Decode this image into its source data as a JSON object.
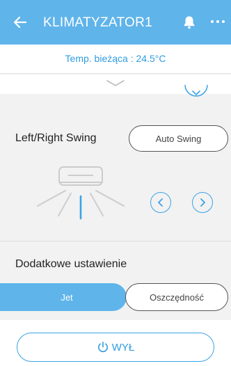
{
  "header": {
    "title": "KLIMATYZATOR1",
    "back_icon": "arrow-left-icon",
    "bell_icon": "bell-icon",
    "more_icon": "more-horizontal-icon",
    "color": "#5fb4ea"
  },
  "status": {
    "current_temp": "Temp. bieżąca : 24.5°C"
  },
  "swing": {
    "label": "Left/Right Swing",
    "mode_button": "Auto Swing",
    "prev_icon": "chevron-left-icon",
    "next_icon": "chevron-right-icon"
  },
  "extra": {
    "label": "Dodatkowe ustawienie",
    "jet": "Jet",
    "eco": "Oszczędność",
    "active": "Jet"
  },
  "power": {
    "label": "WYŁ",
    "icon": "power-icon",
    "accent": "#2f9ce0"
  }
}
